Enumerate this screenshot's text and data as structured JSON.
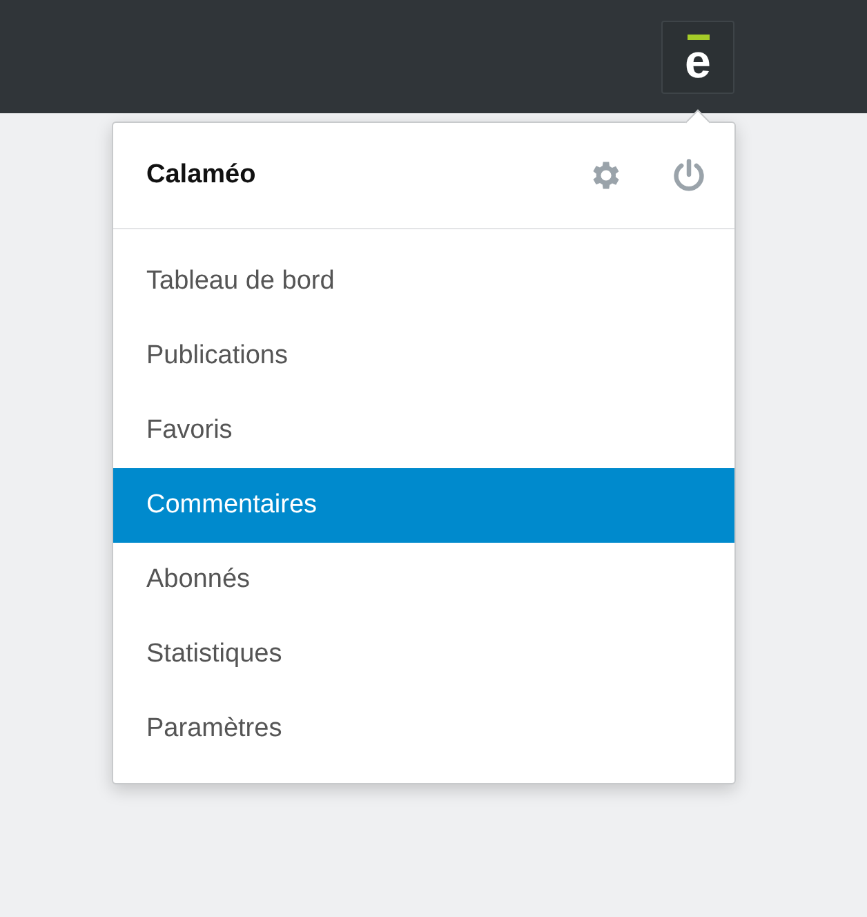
{
  "topbar": {
    "logo_letter": "e"
  },
  "menu": {
    "title": "Calaméo",
    "items": [
      {
        "label": "Tableau de bord",
        "selected": false
      },
      {
        "label": "Publications",
        "selected": false
      },
      {
        "label": "Favoris",
        "selected": false
      },
      {
        "label": "Commentaires",
        "selected": true
      },
      {
        "label": "Abonnés",
        "selected": false
      },
      {
        "label": "Statistiques",
        "selected": false
      },
      {
        "label": "Paramètres",
        "selected": false
      }
    ]
  }
}
